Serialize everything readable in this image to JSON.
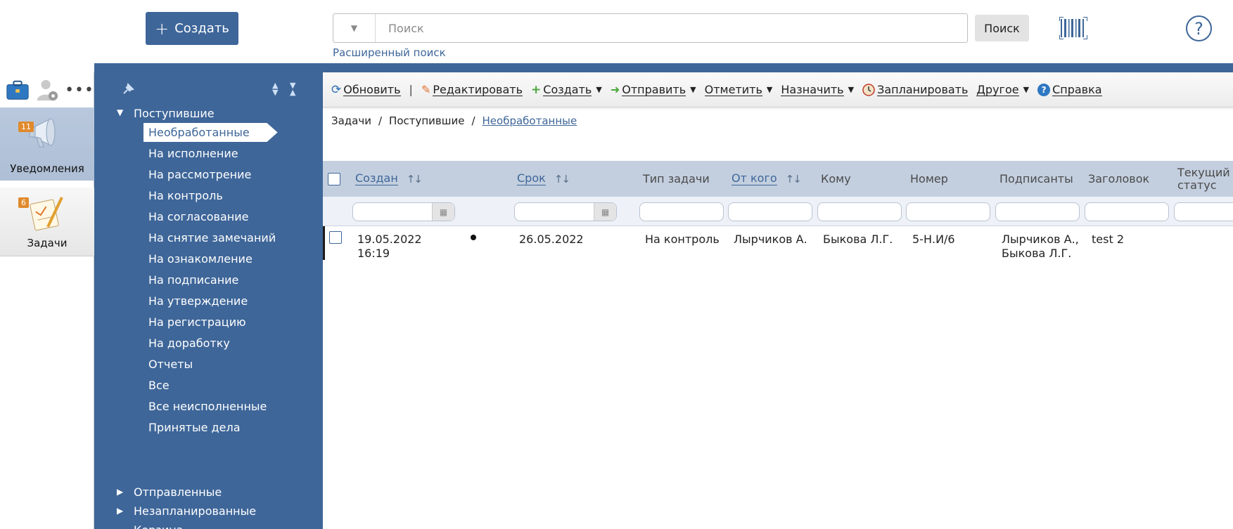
{
  "header": {
    "create_label": "Создать",
    "search_placeholder": "Поиск",
    "search_button": "Поиск",
    "advanced_search": "Расширенный поиск"
  },
  "leftpanel": {
    "notifications": {
      "label": "Уведомления",
      "badge": "11"
    },
    "tasks": {
      "label": "Задачи",
      "badge": "6"
    }
  },
  "tree": {
    "incoming": "Поступившие",
    "items": [
      "Необработанные",
      "На исполнение",
      "На рассмотрение",
      "На контроль",
      "На согласование",
      "На снятие замечаний",
      "На ознакомление",
      "На подписание",
      "На утверждение",
      "На регистрацию",
      "На доработку",
      "Отчеты",
      "Все",
      "Все неисполненные",
      "Принятые дела"
    ],
    "sent": "Отправленные",
    "unplanned": "Незапланированные",
    "trash": "Корзина"
  },
  "toolbar": {
    "refresh": "Обновить",
    "edit": "Редактировать",
    "create": "Создать",
    "send": "Отправить",
    "mark": "Отметить",
    "assign": "Назначить",
    "schedule": "Запланировать",
    "other": "Другое",
    "help": "Справка"
  },
  "breadcrumb": {
    "part1": "Задачи",
    "part2": "Поступившие",
    "current": "Необработанные"
  },
  "grid": {
    "columns": {
      "created": "Создан",
      "due": "Срок",
      "type": "Тип задачи",
      "from": "От кого",
      "to": "Кому",
      "number": "Номер",
      "signers": "Подписанты",
      "title": "Заголовок",
      "status_line1": "Текущий",
      "status_line2": "статус"
    },
    "rows": [
      {
        "created_date": "19.05.2022",
        "created_time": "16:19",
        "due": "26.05.2022",
        "type": "На контроль",
        "from": "Лырчиков А.",
        "to": "Быкова Л.Г.",
        "number": "5-Н.И/6",
        "signers_line1": "Лырчиков А.,",
        "signers_line2": "Быкова Л.Г.",
        "title": "test 2"
      }
    ]
  },
  "colors": {
    "brand": "#3e6699",
    "header_band": "#c3cfdf",
    "badge": "#e08a2c"
  }
}
